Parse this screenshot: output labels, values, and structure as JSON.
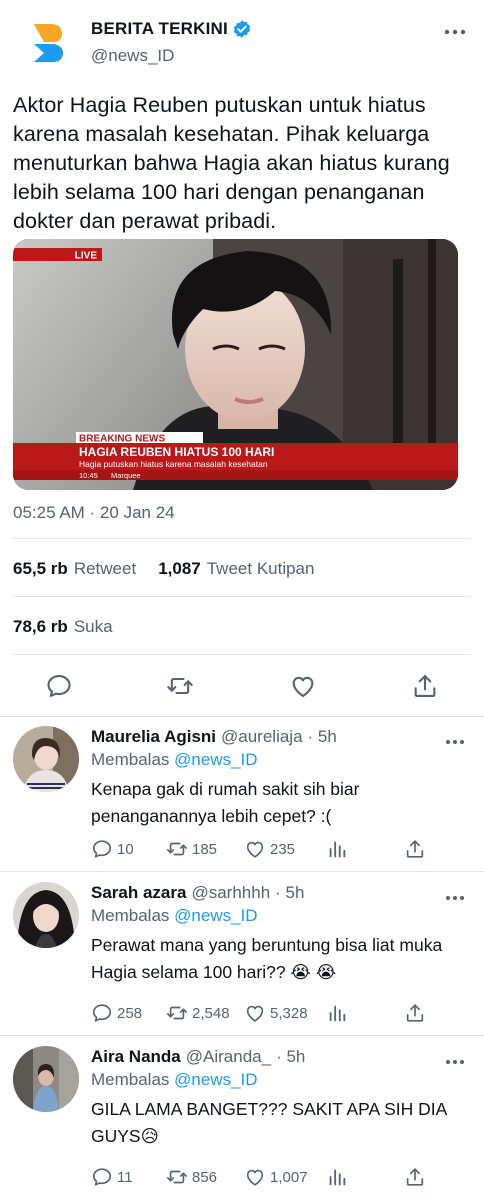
{
  "tweet": {
    "display_name": "BERITA TERKINI",
    "handle": "@news_ID",
    "text": "Aktor Hagia Reuben putuskan untuk hiatus karena masalah kesehatan. Pihak keluarga menuturkan bahwa Hagia akan hiatus kurang lebih selama 100 hari dengan penanganan dokter dan perawat pribadi.",
    "media": {
      "live_label": "LIVE",
      "breaking_label": "BREAKING NEWS",
      "headline": "HAGIA REUBEN HIATUS 100 HARI",
      "subline": "Hagia putuskan hiatus karena masalah kesehatan",
      "clock": "10:45",
      "ticker": "Marquee"
    },
    "timestamp": "05:25 AM · 20 Jan 24",
    "stats": {
      "retweets": "65,5 rb",
      "retweets_label": "Retweet",
      "quotes": "1,087",
      "quotes_label": "Tweet Kutipan",
      "likes": "78,6 rb",
      "likes_label": "Suka"
    },
    "icons": [
      "reply-icon",
      "retweet-icon",
      "like-icon",
      "share-icon"
    ],
    "accent_color": "#1d9bf0"
  },
  "replies": [
    {
      "name": "Maurelia Agisni",
      "handle": "@aureliaja",
      "time": "· 5h",
      "replying_label": "Membalas",
      "replying_to": "@news_ID",
      "text": "Kenapa gak di rumah sakit sih biar penanganannya lebih cepet? :(",
      "reply_count": "10",
      "retweet_count": "185",
      "like_count": "235"
    },
    {
      "name": "Sarah azara",
      "handle": "@sarhhhh",
      "time": "· 5h",
      "replying_label": "Membalas",
      "replying_to": "@news_ID",
      "text": "Perawat mana yang beruntung bisa liat muka Hagia selama 100 hari?? 😭 😭",
      "reply_count": "258",
      "retweet_count": "2,548",
      "like_count": "5,328"
    },
    {
      "name": "Aira Nanda",
      "handle": "@Airanda_",
      "time": "· 5h",
      "replying_label": "Membalas",
      "replying_to": "@news_ID",
      "text": "GILA LAMA BANGET??? SAKIT APA SIH DIA GUYS😥",
      "reply_count": "11",
      "retweet_count": "856",
      "like_count": "1,007"
    }
  ]
}
